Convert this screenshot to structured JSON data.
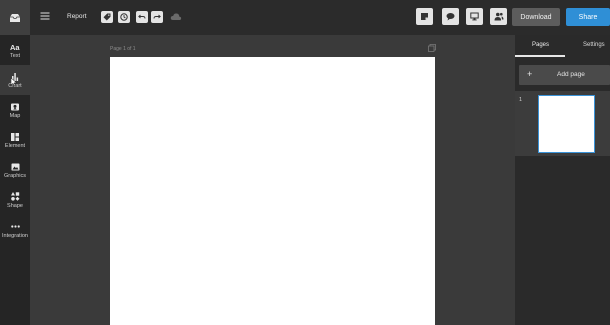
{
  "sidebar": {
    "logo_icon": "inbox-icon",
    "items": [
      {
        "label": "Text",
        "icon": "text-icon"
      },
      {
        "label": "Chart",
        "icon": "chart-icon"
      },
      {
        "label": "Map",
        "icon": "map-icon"
      },
      {
        "label": "Element",
        "icon": "element-icon"
      },
      {
        "label": "Graphics",
        "icon": "image-icon"
      },
      {
        "label": "Shape",
        "icon": "shape-icon"
      },
      {
        "label": "Integration",
        "icon": "more-icon"
      }
    ]
  },
  "header": {
    "title": "Report",
    "download_label": "Download",
    "share_label": "Share"
  },
  "canvas": {
    "page_label": "Page 1 of 1"
  },
  "right_panel": {
    "tabs": [
      "Pages",
      "Settings"
    ],
    "add_page_label": "Add page",
    "page_number": "1"
  },
  "colors": {
    "accent": "#2f8fd6",
    "sidebar_bg": "#252525",
    "workspace_bg": "#3a3a3a"
  }
}
